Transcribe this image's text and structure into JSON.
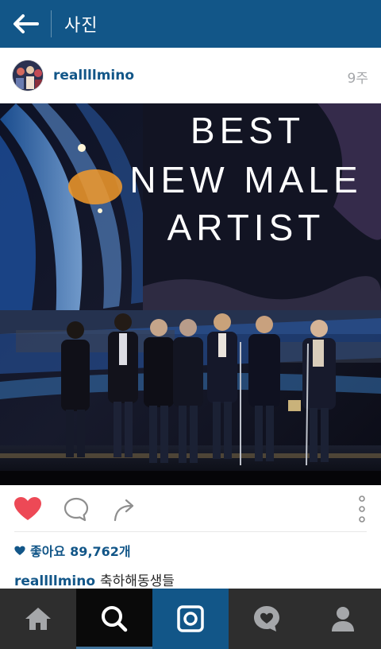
{
  "app_bar": {
    "title": "사진",
    "back_icon": "arrow-left-icon"
  },
  "post": {
    "username": "reallllmino",
    "time_ago": "9주",
    "photo_text_lines": [
      "BEST",
      "NEW MALE",
      "ARTIST"
    ],
    "likes_label": "좋아요",
    "likes_count": "89,762개",
    "caption_user": "reallllmino",
    "caption_text": "축하해동생들"
  },
  "actions": {
    "liked": true,
    "like_icon": "heart-icon",
    "comment_icon": "comment-bubble-icon",
    "share_icon": "share-arrow-icon",
    "more_icon": "more-vertical-icon"
  },
  "tabs": [
    {
      "name": "home",
      "icon": "home-icon",
      "active": false
    },
    {
      "name": "search",
      "icon": "search-icon",
      "active": true
    },
    {
      "name": "camera",
      "icon": "camera-icon",
      "active": false
    },
    {
      "name": "activity",
      "icon": "heart-bubble-icon",
      "active": false
    },
    {
      "name": "profile",
      "icon": "person-icon",
      "active": false
    }
  ],
  "colors": {
    "brand_blue": "#125688",
    "like_red": "#ed4956",
    "tab_bar": "#2e2e2e",
    "text_gray": "#a5a7aa"
  }
}
